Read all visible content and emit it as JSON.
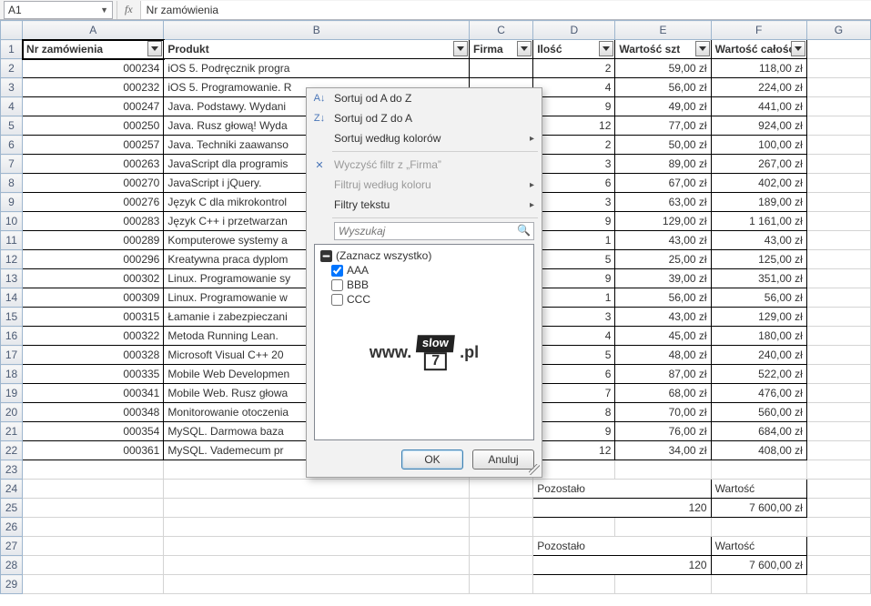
{
  "formula_bar": {
    "name_box": "A1",
    "fx_label": "fx",
    "formula": "Nr zamówienia"
  },
  "columns": [
    "A",
    "B",
    "C",
    "D",
    "E",
    "F",
    "G"
  ],
  "headers": {
    "A": "Nr zamówienia",
    "B": "Produkt",
    "C": "Firma",
    "D": "Ilość",
    "E": "Wartość szt",
    "F": "Wartość całość"
  },
  "rows": [
    {
      "n": "000234",
      "p": "iOS 5. Podręcznik progra",
      "d": "2",
      "e": "59,00 zł",
      "f": "118,00 zł"
    },
    {
      "n": "000232",
      "p": "iOS 5. Programowanie. R",
      "d": "4",
      "e": "56,00 zł",
      "f": "224,00 zł"
    },
    {
      "n": "000247",
      "p": "Java. Podstawy. Wydani",
      "d": "9",
      "e": "49,00 zł",
      "f": "441,00 zł"
    },
    {
      "n": "000250",
      "p": "Java. Rusz głową! Wyda",
      "d": "12",
      "e": "77,00 zł",
      "f": "924,00 zł"
    },
    {
      "n": "000257",
      "p": "Java. Techniki zaawanso",
      "d": "2",
      "e": "50,00 zł",
      "f": "100,00 zł"
    },
    {
      "n": "000263",
      "p": "JavaScript dla programis",
      "d": "3",
      "e": "89,00 zł",
      "f": "267,00 zł"
    },
    {
      "n": "000270",
      "p": "JavaScript i jQuery.",
      "d": "6",
      "e": "67,00 zł",
      "f": "402,00 zł"
    },
    {
      "n": "000276",
      "p": "Język C dla mikrokontrol",
      "d": "3",
      "e": "63,00 zł",
      "f": "189,00 zł"
    },
    {
      "n": "000283",
      "p": "Język C++ i przetwarzan",
      "d": "9",
      "e": "129,00 zł",
      "f": "1 161,00 zł"
    },
    {
      "n": "000289",
      "p": "Komputerowe systemy a",
      "d": "1",
      "e": "43,00 zł",
      "f": "43,00 zł"
    },
    {
      "n": "000296",
      "p": "Kreatywna praca dyplom",
      "d": "5",
      "e": "25,00 zł",
      "f": "125,00 zł"
    },
    {
      "n": "000302",
      "p": "Linux. Programowanie sy",
      "d": "9",
      "e": "39,00 zł",
      "f": "351,00 zł"
    },
    {
      "n": "000309",
      "p": "Linux. Programowanie w",
      "d": "1",
      "e": "56,00 zł",
      "f": "56,00 zł"
    },
    {
      "n": "000315",
      "p": "Łamanie i zabezpieczani",
      "d": "3",
      "e": "43,00 zł",
      "f": "129,00 zł"
    },
    {
      "n": "000322",
      "p": "Metoda Running Lean.",
      "d": "4",
      "e": "45,00 zł",
      "f": "180,00 zł"
    },
    {
      "n": "000328",
      "p": "Microsoft Visual C++ 20",
      "d": "5",
      "e": "48,00 zł",
      "f": "240,00 zł"
    },
    {
      "n": "000335",
      "p": "Mobile Web Developmen",
      "d": "6",
      "e": "87,00 zł",
      "f": "522,00 zł"
    },
    {
      "n": "000341",
      "p": "Mobile Web. Rusz głowa",
      "d": "7",
      "e": "68,00 zł",
      "f": "476,00 zł"
    },
    {
      "n": "000348",
      "p": "Monitorowanie otoczenia",
      "d": "8",
      "e": "70,00 zł",
      "f": "560,00 zł"
    },
    {
      "n": "000354",
      "p": "MySQL. Darmowa baza",
      "d": "9",
      "e": "76,00 zł",
      "f": "684,00 zł"
    },
    {
      "n": "000361",
      "p": "MySQL. Vademecum pr",
      "d": "12",
      "e": "34,00 zł",
      "f": "408,00 zł"
    }
  ],
  "summary": {
    "label_remain": "Pozostało",
    "label_value": "Wartość",
    "remain_value": "120",
    "total_value": "7 600,00 zł"
  },
  "filter_menu": {
    "sort_az": "Sortuj od A do Z",
    "sort_za": "Sortuj od Z do A",
    "sort_color": "Sortuj według kolorów",
    "clear": "Wyczyść filtr z „Firma”",
    "filter_color": "Filtruj według koloru",
    "filter_text": "Filtry tekstu",
    "search_placeholder": "Wyszukaj",
    "select_all": "(Zaznacz wszystko)",
    "items": [
      "AAA",
      "BBB",
      "CCC"
    ],
    "ok": "OK",
    "cancel": "Anuluj"
  },
  "watermark": {
    "prefix": "www.",
    "mid1": "slow",
    "mid2": "7",
    "suffix": ".pl"
  }
}
